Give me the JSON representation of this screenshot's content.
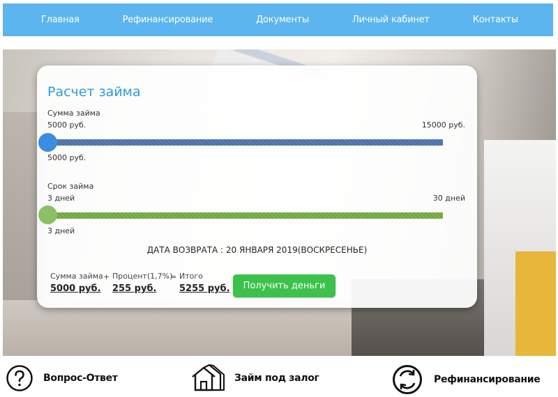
{
  "nav": {
    "items": [
      "Главная",
      "Рефинансирование",
      "Документы",
      "Личный кабинет",
      "Контакты"
    ]
  },
  "calculator": {
    "title": "Расчет займа",
    "amount": {
      "label": "Сумма займа",
      "min_label": "5000 руб.",
      "max_label": "15000 руб.",
      "selected_label": "5000 руб.",
      "slider_level": 0.0,
      "color": "#4a6ea8"
    },
    "term": {
      "label": "Срок займа",
      "min_label": "3 дней",
      "max_label": "30 дней",
      "selected_label": "3 дней",
      "slider_level": 0.0,
      "color": "#6fa33e"
    },
    "return_date": "ДАТА ВОЗВРАТА : 20 ЯНВАРЯ 2019(ВОСКРЕСЕНЬЕ)",
    "summary": {
      "loan_caption": "Сумма займа",
      "loan_value": "5000 руб.",
      "plus": "+",
      "interest_caption": "Процент(1,7%)",
      "interest_value": "255 руб.",
      "equals": "=",
      "total_caption": "Итого",
      "total_value": "5255 руб."
    },
    "cta_label": "Получить деньги",
    "accent_color": "#2f9bd6",
    "cta_color": "#3cc14a"
  },
  "features": {
    "faq": "Вопрос-Ответ",
    "pledge": "Займ под залог",
    "refinance": "Рефинансирование"
  },
  "icons": {
    "faq": "question-circle-icon",
    "pledge": "houses-icon",
    "refinance": "refresh-circle-icon"
  }
}
